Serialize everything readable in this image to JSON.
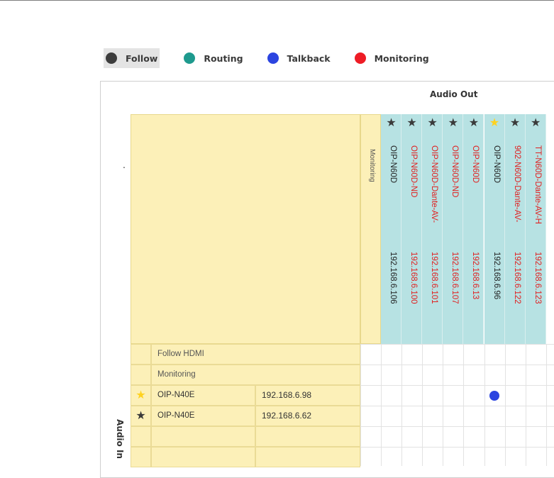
{
  "legend": [
    {
      "label": "Follow",
      "color": "#3d3d3d",
      "active": true
    },
    {
      "label": "Routing",
      "color": "#1e9a8e"
    },
    {
      "label": "Talkback",
      "color": "#2b44e0"
    },
    {
      "label": "Monitoring",
      "color": "#ee1c25"
    }
  ],
  "matrix": {
    "audio_out_label": "Audio Out",
    "audio_in_label": "Audio In",
    "corner_mark": ".",
    "monitoring_col_label": "Monitoring",
    "columns": [
      {
        "name": "OIP-N60D",
        "ip": "192.168.6.106",
        "text_color": "#222222",
        "starred": false
      },
      {
        "name": "OIP-N60D-ND",
        "ip": "192.168.6.100",
        "text_color": "#e02020",
        "starred": false
      },
      {
        "name": "OIP-N60D-Dante-AV-",
        "ip": "192.168.6.101",
        "text_color": "#e02020",
        "starred": false
      },
      {
        "name": "OIP-N60D-ND",
        "ip": "192.168.6.107",
        "text_color": "#e02020",
        "starred": false
      },
      {
        "name": "OIP-N60D",
        "ip": "192.168.6.13",
        "text_color": "#e02020",
        "starred": false
      },
      {
        "name": "OIP-N60D",
        "ip": "192.168.6.96",
        "text_color": "#222222",
        "starred": true
      },
      {
        "name": "902-N60D-Dante-AV-",
        "ip": "192.168.6.122",
        "text_color": "#e02020",
        "starred": false
      },
      {
        "name": "TT-N60D-Dante-AV-H",
        "ip": "192.168.6.123",
        "text_color": "#e02020",
        "starred": false
      }
    ],
    "special_rows": [
      "Follow HDMI",
      "Monitoring"
    ],
    "rows": [
      {
        "name": "OIP-N40E",
        "ip": "192.168.6.98",
        "starred": true
      },
      {
        "name": "OIP-N40E",
        "ip": "192.168.6.62",
        "starred": false
      },
      {
        "name": "",
        "ip": "",
        "starred": null
      },
      {
        "name": "",
        "ip": "",
        "starred": null
      }
    ],
    "star_glyph": "★",
    "star_color_default": "#3a3a3a",
    "star_color_active": "#ffd21f",
    "routes": [
      {
        "row": 0,
        "col": 5,
        "type": "Talkback",
        "color": "#2b44e0"
      }
    ]
  }
}
